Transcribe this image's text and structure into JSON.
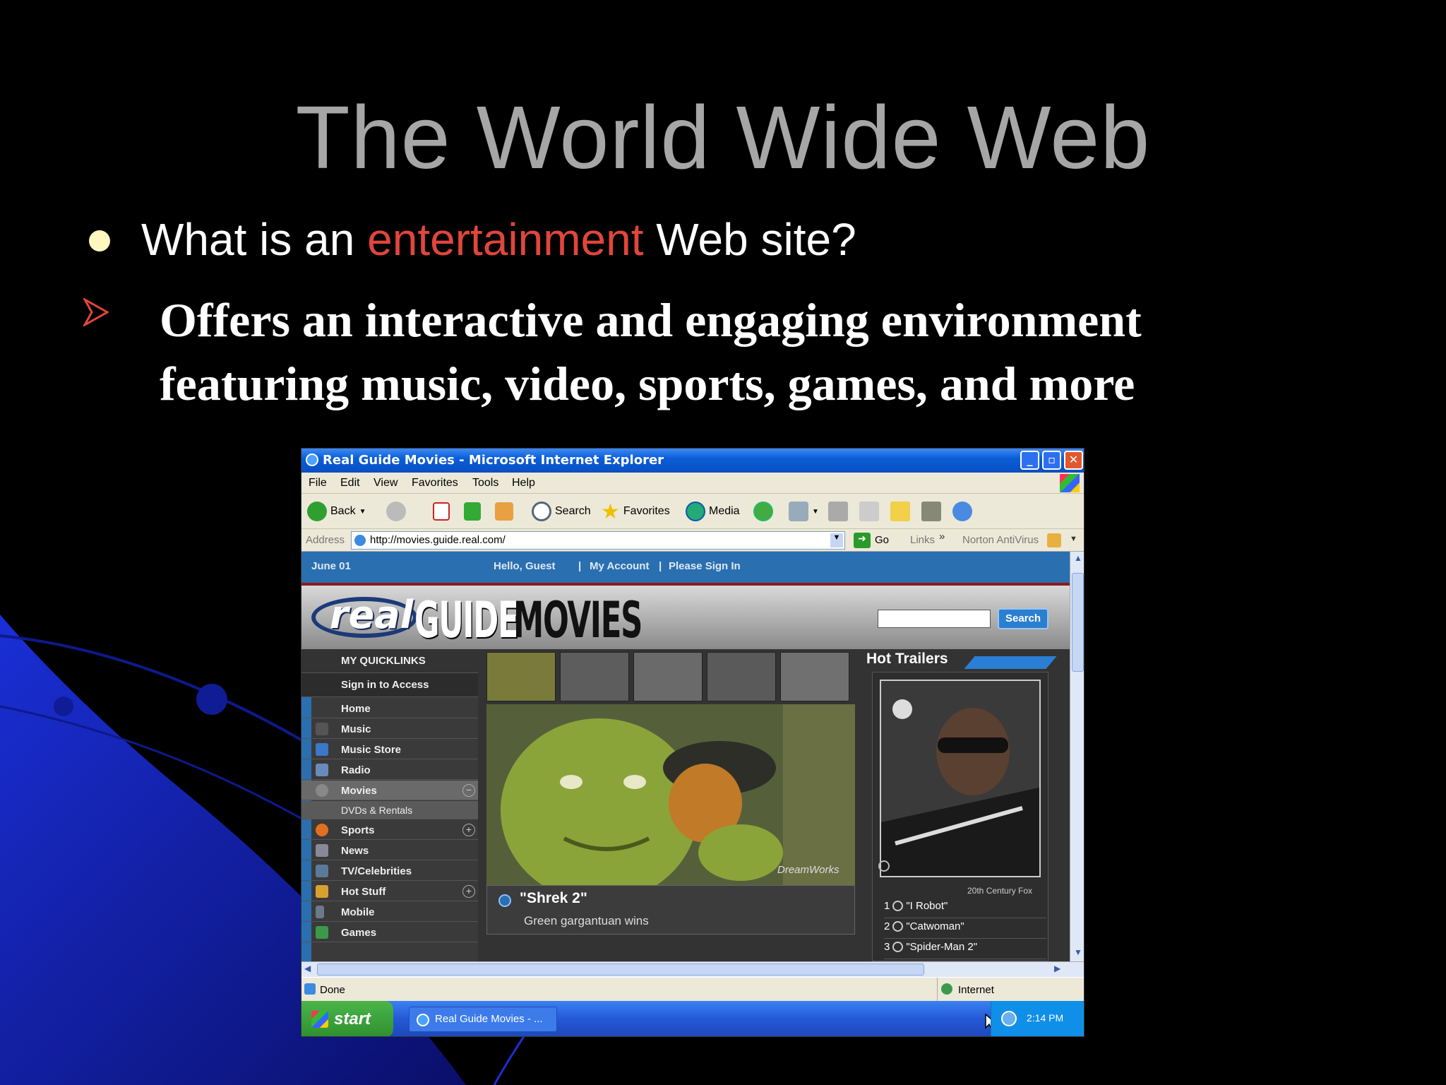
{
  "slide": {
    "title": "The World Wide Web",
    "question_prefix": "What is an ",
    "question_highlight": "entertainment",
    "question_suffix": " Web site?",
    "answer": "Offers an interactive and engaging environment featuring music, video, sports, games, and more",
    "colors": {
      "background": "#000000",
      "title": "#a6a6a6",
      "highlight": "#e0463c"
    }
  },
  "browser": {
    "window_title": "Real Guide Movies - Microsoft Internet Explorer",
    "menu": [
      "File",
      "Edit",
      "View",
      "Favorites",
      "Tools",
      "Help"
    ],
    "toolbar": {
      "back": "Back",
      "search": "Search",
      "favorites": "Favorites",
      "media": "Media"
    },
    "address_label": "Address",
    "url": "http://movies.guide.real.com/",
    "go": "Go",
    "links": "Links",
    "norton": "Norton AntiVirus",
    "status": "Done",
    "zone": "Internet"
  },
  "site": {
    "date": "June 01",
    "greeting": "Hello, Guest",
    "my_account": "My Account",
    "sign_in": "Please Sign In",
    "logo_real": "real",
    "logo_guide": "GUIDE",
    "logo_movies": "MOVIES",
    "search_button": "Search",
    "sidebar": [
      {
        "label": "MY QUICKLINKS"
      },
      {
        "label": "Sign in to Access"
      },
      {
        "label": "Home"
      },
      {
        "label": "Music"
      },
      {
        "label": "Music Store"
      },
      {
        "label": "Radio"
      },
      {
        "label": "Movies"
      },
      {
        "label": "DVDs & Rentals"
      },
      {
        "label": "Sports"
      },
      {
        "label": "News"
      },
      {
        "label": "TV/Celebrities"
      },
      {
        "label": "Hot Stuff"
      },
      {
        "label": "Mobile"
      },
      {
        "label": "Games"
      }
    ],
    "feature": {
      "title": "\"Shrek 2\"",
      "subtitle": "Green gargantuan wins",
      "credit": "DreamWorks"
    },
    "hot_trailers": {
      "heading": "Hot Trailers",
      "credit": "20th Century Fox",
      "items": [
        {
          "num": "1",
          "title": "\"I Robot\""
        },
        {
          "num": "2",
          "title": "\"Catwoman\""
        },
        {
          "num": "3",
          "title": "\"Spider-Man 2\""
        }
      ]
    }
  },
  "taskbar": {
    "start": "start",
    "task": "Real Guide Movies - ...",
    "time": "2:14 PM"
  }
}
